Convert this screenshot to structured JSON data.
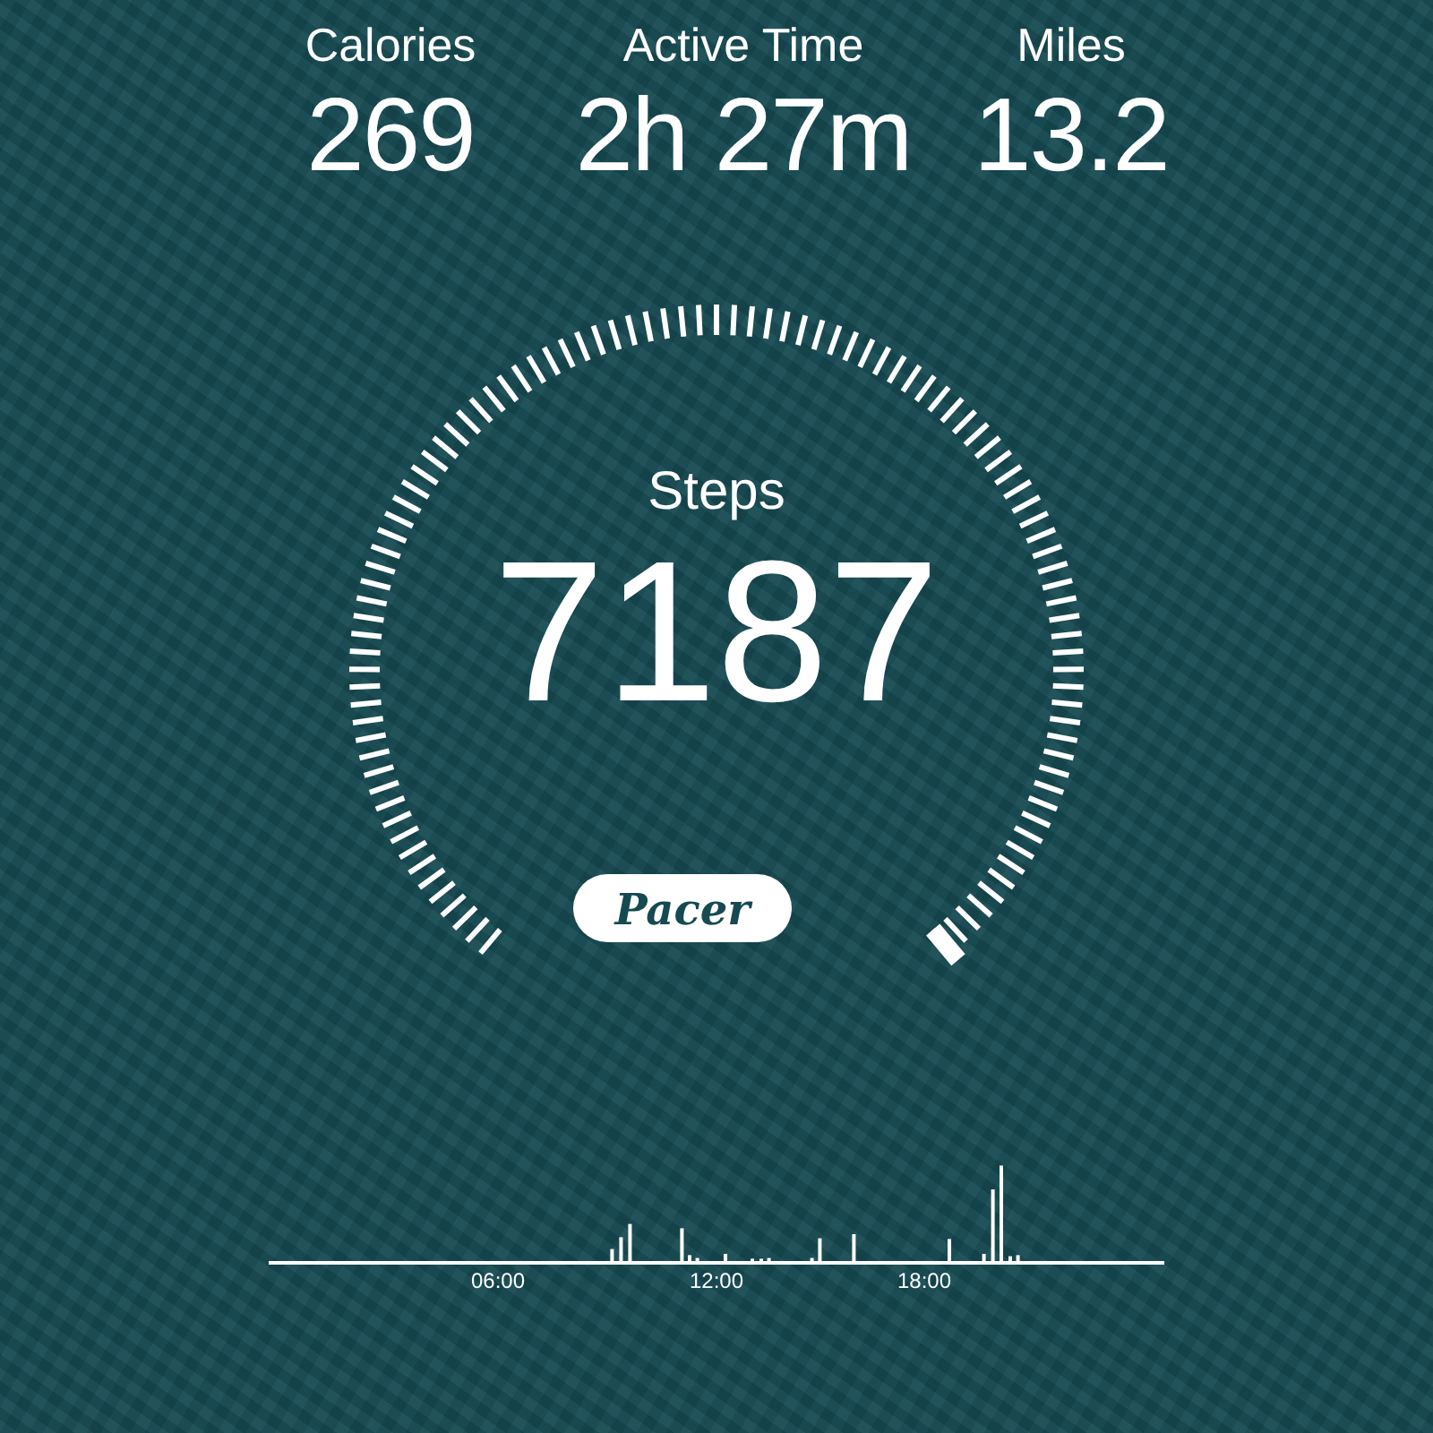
{
  "stats": [
    {
      "label": "Calories",
      "value": "269"
    },
    {
      "label": "Active Time",
      "value": "2h 27m"
    },
    {
      "label": "Miles",
      "value": "13.2"
    }
  ],
  "gauge": {
    "label": "Steps",
    "value": "7187"
  },
  "logo_button": {
    "label": "Pacer"
  },
  "timeline": {
    "labels": [
      "06:00",
      "12:00",
      "18:00"
    ]
  }
}
